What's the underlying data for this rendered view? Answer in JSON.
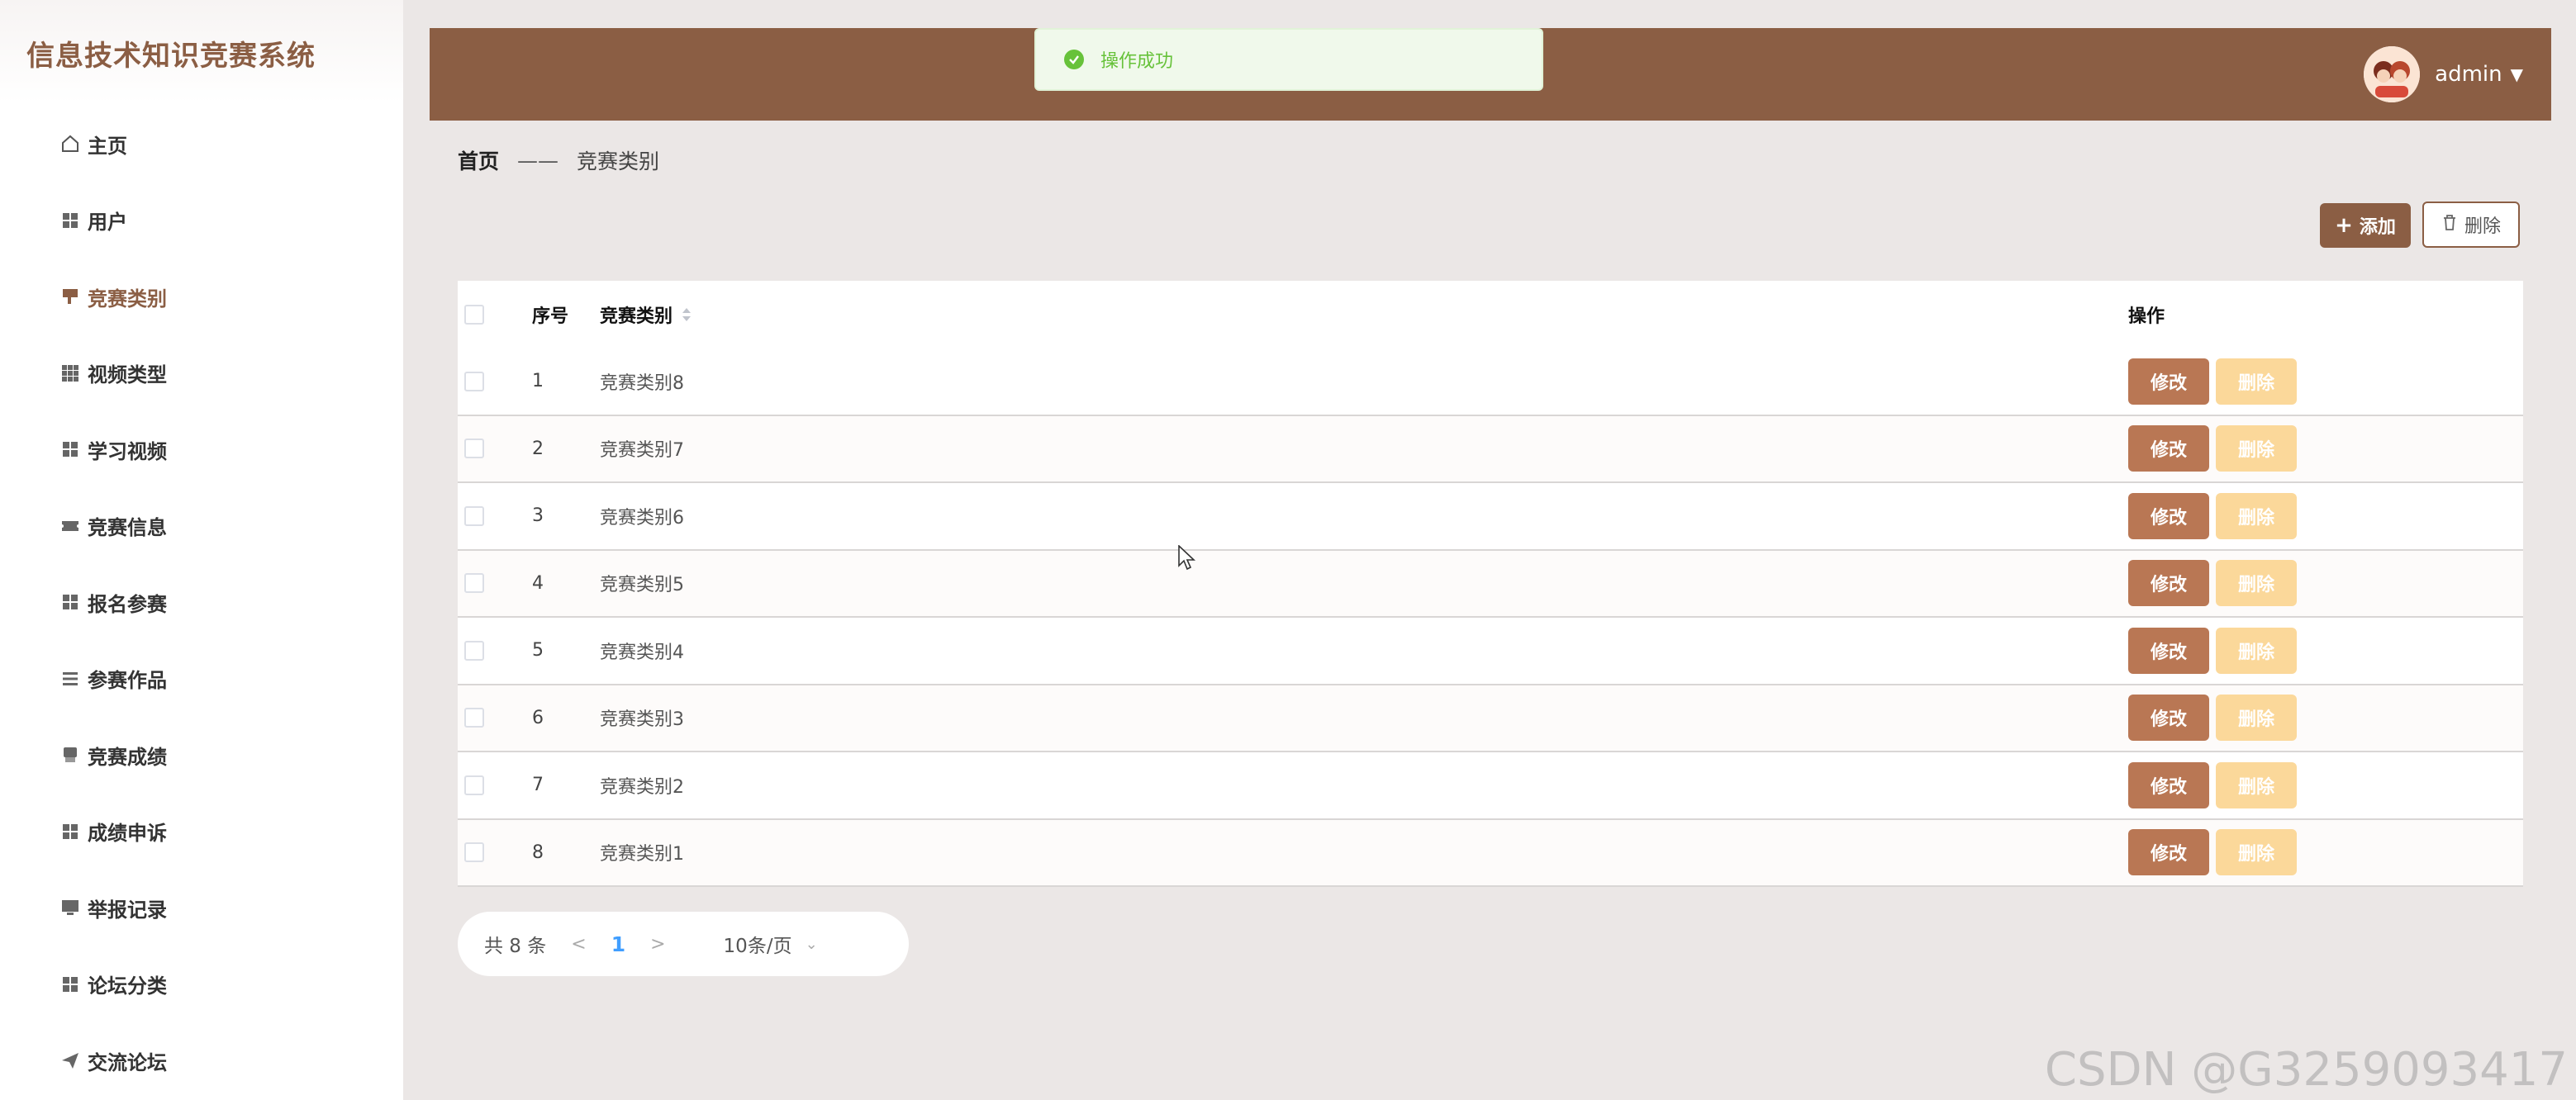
{
  "app": {
    "title": "信息技术知识竞赛系统"
  },
  "sidebar": {
    "items": [
      {
        "label": "主页",
        "icon": "home-icon"
      },
      {
        "label": "用户",
        "icon": "grid-icon"
      },
      {
        "label": "竞赛类别",
        "icon": "category-icon",
        "active": true
      },
      {
        "label": "视频类型",
        "icon": "grid9-icon"
      },
      {
        "label": "学习视频",
        "icon": "grid-icon"
      },
      {
        "label": "竞赛信息",
        "icon": "ticket-icon"
      },
      {
        "label": "报名参赛",
        "icon": "grid-icon"
      },
      {
        "label": "参赛作品",
        "icon": "list-icon"
      },
      {
        "label": "竞赛成绩",
        "icon": "printer-icon"
      },
      {
        "label": "成绩申诉",
        "icon": "grid-icon"
      },
      {
        "label": "举报记录",
        "icon": "monitor-icon"
      },
      {
        "label": "论坛分类",
        "icon": "grid-icon"
      },
      {
        "label": "交流论坛",
        "icon": "send-icon"
      }
    ]
  },
  "header": {
    "username": "admin"
  },
  "toast": {
    "message": "操作成功"
  },
  "breadcrumb": {
    "home": "首页",
    "separator": "——",
    "current": "竞赛类别"
  },
  "toolbar": {
    "add_label": "添加",
    "delete_label": "删除"
  },
  "table": {
    "headers": {
      "index": "序号",
      "name": "竞赛类别",
      "ops": "操作"
    },
    "rows": [
      {
        "index": "1",
        "name": "竞赛类别8"
      },
      {
        "index": "2",
        "name": "竞赛类别7"
      },
      {
        "index": "3",
        "name": "竞赛类别6"
      },
      {
        "index": "4",
        "name": "竞赛类别5"
      },
      {
        "index": "5",
        "name": "竞赛类别4"
      },
      {
        "index": "6",
        "name": "竞赛类别3"
      },
      {
        "index": "7",
        "name": "竞赛类别2"
      },
      {
        "index": "8",
        "name": "竞赛类别1"
      }
    ],
    "edit_label": "修改",
    "delete_label": "删除"
  },
  "pagination": {
    "total": "共 8 条",
    "prev": "<",
    "current": "1",
    "next": ">",
    "page_size": "10条/页"
  },
  "watermark": "CSDN @G3259093417",
  "colors": {
    "brand": "#8b5e44",
    "edit_button": "#b97754",
    "delete_button": "#fbd89a",
    "success": "#67c23a"
  }
}
